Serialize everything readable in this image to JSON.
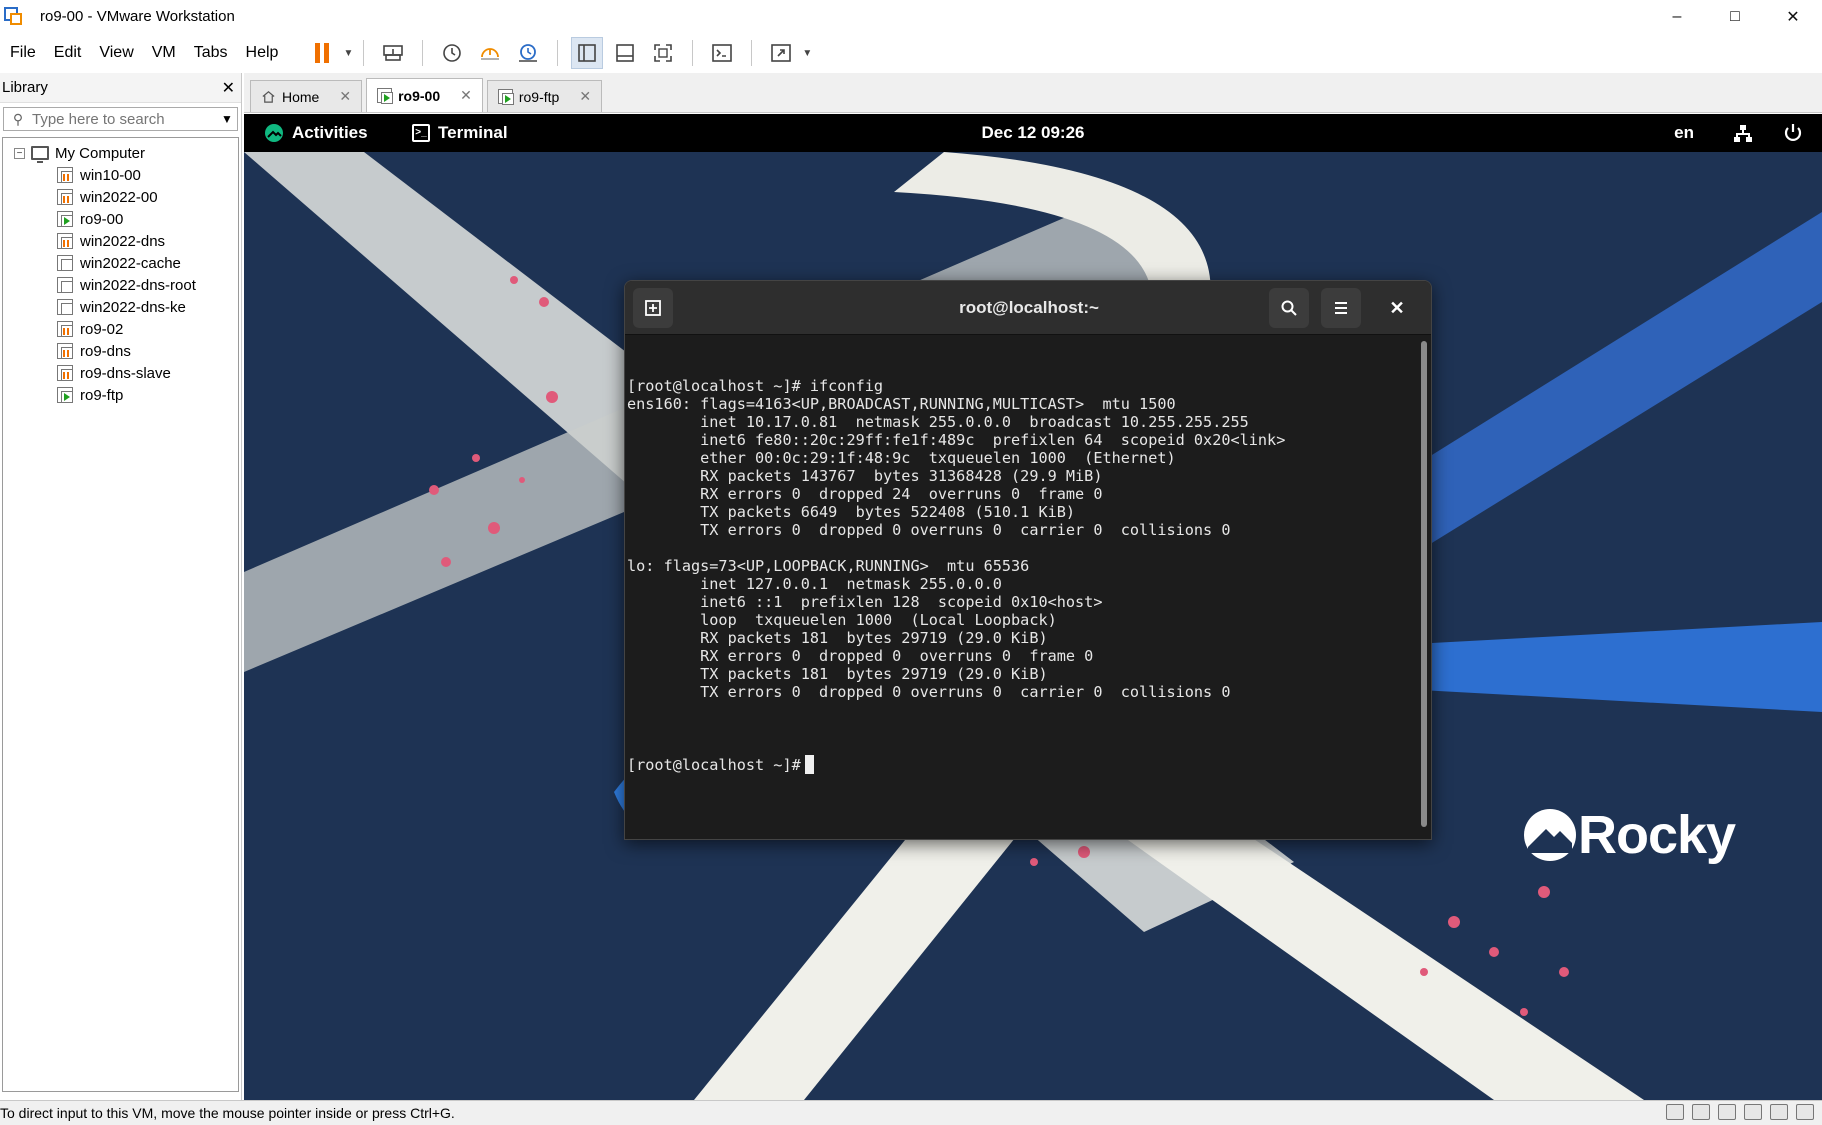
{
  "window": {
    "title": "ro9-00 - VMware Workstation",
    "minimize": "–",
    "maximize": "□",
    "close": "✕"
  },
  "menu": [
    "File",
    "Edit",
    "View",
    "VM",
    "Tabs",
    "Help"
  ],
  "library": {
    "title": "Library",
    "close": "✕",
    "search_placeholder": "Type here to search",
    "root_label": "My Computer",
    "root_toggle": "−",
    "vms": [
      {
        "name": "win10-00",
        "state": "suspended"
      },
      {
        "name": "win2022-00",
        "state": "suspended"
      },
      {
        "name": "ro9-00",
        "state": "running"
      },
      {
        "name": "win2022-dns",
        "state": "suspended"
      },
      {
        "name": "win2022-cache",
        "state": "off"
      },
      {
        "name": "win2022-dns-root",
        "state": "off"
      },
      {
        "name": "win2022-dns-ke",
        "state": "off"
      },
      {
        "name": "ro9-02",
        "state": "suspended"
      },
      {
        "name": "ro9-dns",
        "state": "suspended"
      },
      {
        "name": "ro9-dns-slave",
        "state": "suspended"
      },
      {
        "name": "ro9-ftp",
        "state": "running"
      }
    ]
  },
  "tabs": [
    {
      "label": "Home",
      "active": false
    },
    {
      "label": "ro9-00",
      "active": true
    },
    {
      "label": "ro9-ftp",
      "active": false
    }
  ],
  "tab_close": "✕",
  "gnome": {
    "activities": "Activities",
    "app": "Terminal",
    "clock": "Dec 12  09:26",
    "lang": "en"
  },
  "terminal": {
    "title": "root@localhost:~",
    "close": "✕",
    "lines": [
      "[root@localhost ~]# ifconfig",
      "ens160: flags=4163<UP,BROADCAST,RUNNING,MULTICAST>  mtu 1500",
      "        inet 10.17.0.81  netmask 255.0.0.0  broadcast 10.255.255.255",
      "        inet6 fe80::20c:29ff:fe1f:489c  prefixlen 64  scopeid 0x20<link>",
      "        ether 00:0c:29:1f:48:9c  txqueuelen 1000  (Ethernet)",
      "        RX packets 143767  bytes 31368428 (29.9 MiB)",
      "        RX errors 0  dropped 24  overruns 0  frame 0",
      "        TX packets 6649  bytes 522408 (510.1 KiB)",
      "        TX errors 0  dropped 0 overruns 0  carrier 0  collisions 0",
      "",
      "lo: flags=73<UP,LOOPBACK,RUNNING>  mtu 65536",
      "        inet 127.0.0.1  netmask 255.0.0.0",
      "        inet6 ::1  prefixlen 128  scopeid 0x10<host>",
      "        loop  txqueuelen 1000  (Local Loopback)",
      "        RX packets 181  bytes 29719 (29.0 KiB)",
      "        RX errors 0  dropped 0  overruns 0  frame 0",
      "        TX packets 181  bytes 29719 (29.0 KiB)",
      "        TX errors 0  dropped 0 overruns 0  carrier 0  collisions 0",
      ""
    ],
    "prompt": "[root@localhost ~]#"
  },
  "logo_text": "Rocky",
  "status_text": "To direct input to this VM, move the mouse pointer inside or press Ctrl+G.",
  "colors": {
    "wallpaper": "#1e3354",
    "accent_pause": "#f07000",
    "terminal_bg": "#1c1c1c",
    "rocky_green": "#10b981"
  }
}
